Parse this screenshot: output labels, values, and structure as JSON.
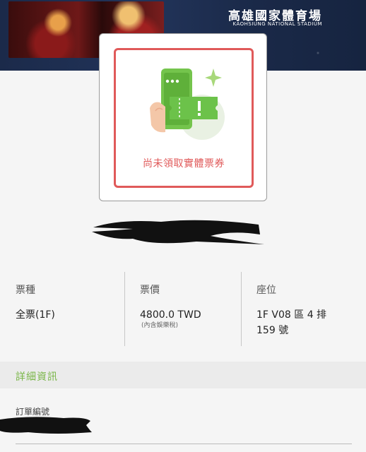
{
  "banner": {
    "venue_name": "高雄國家體育場",
    "venue_name_en": "KAOHSIUNG NATIONAL STADIUM"
  },
  "ticket": {
    "status_text": "尚未領取實體票券",
    "icon": "ticket-phone-icon",
    "colors": {
      "accent_red": "#e05a5a",
      "ticket_green": "#6cc24a"
    }
  },
  "details": {
    "type_label": "票種",
    "type_value": "全票(1F)",
    "price_label": "票價",
    "price_value": "4800.0 TWD",
    "price_note": "(內含娛樂稅)",
    "seat_label": "座位",
    "seat_value_line1": "1F V08 區 4 排",
    "seat_value_line2": "159 號"
  },
  "section": {
    "title": "詳細資訊",
    "color": "#7ab648"
  },
  "order": {
    "label": "訂單編號"
  }
}
